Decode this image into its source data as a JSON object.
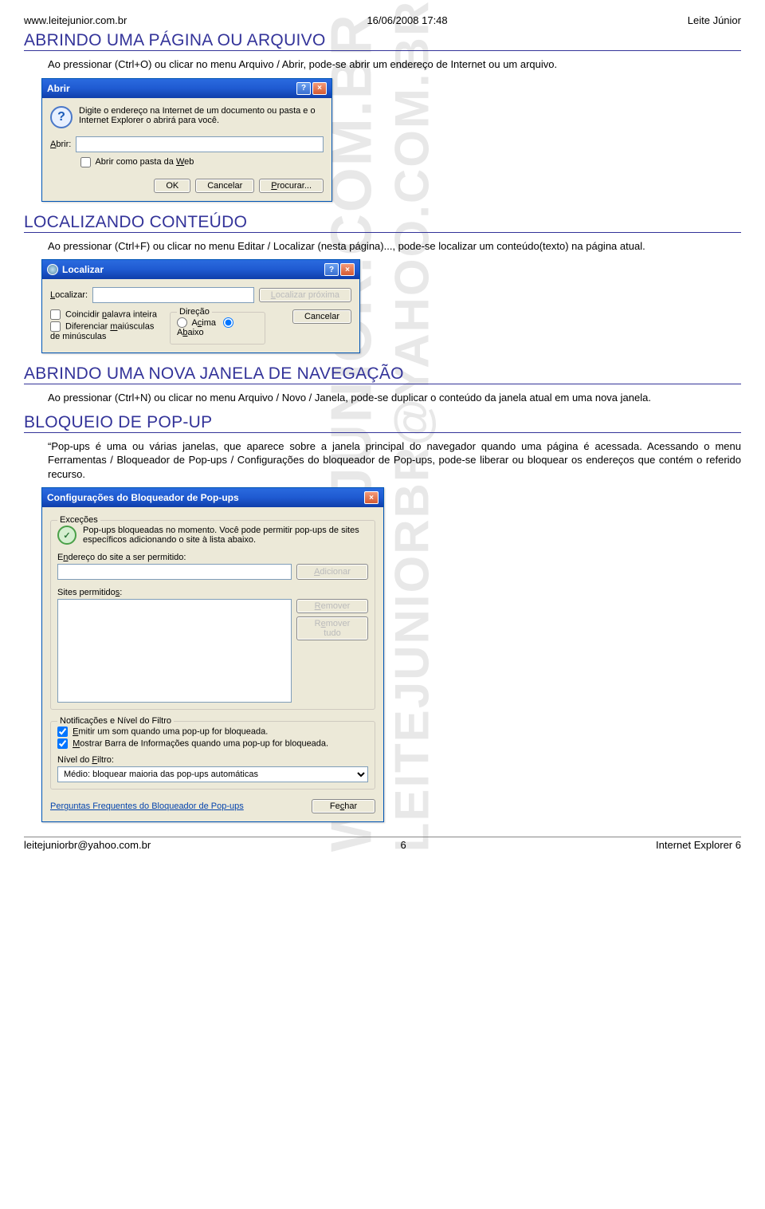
{
  "header": {
    "left": "www.leitejunior.com.br",
    "center": "16/06/2008 17:48",
    "right": "Leite Júnior"
  },
  "sections": {
    "s1": {
      "title": "ABRINDO UMA PÁGINA OU ARQUIVO",
      "para": "Ao pressionar (Ctrl+O) ou clicar no menu Arquivo / Abrir, pode-se abrir um endereço de Internet ou um arquivo."
    },
    "s2": {
      "title": "LOCALIZANDO CONTEÚDO",
      "para": "Ao pressionar (Ctrl+F) ou clicar no menu Editar / Localizar (nesta página)..., pode-se localizar um conteúdo(texto) na página atual."
    },
    "s3": {
      "title": "ABRINDO UMA NOVA JANELA DE NAVEGAÇÃO",
      "para": "Ao pressionar (Ctrl+N) ou clicar no menu Arquivo / Novo / Janela, pode-se duplicar o conteúdo da janela atual em uma nova janela."
    },
    "s4": {
      "title": "BLOQUEIO DE POP-UP",
      "para": "“Pop-ups é uma ou várias janelas, que aparece sobre a janela principal do navegador quando uma página é acessada. Acessando o menu Ferramentas / Bloqueador de Pop-ups / Configurações do bloqueador de Pop-ups, pode-se liberar ou bloquear os endereços que contém o referido recurso."
    }
  },
  "abrir_dialog": {
    "title": "Abrir",
    "prompt": "Digite o endereço na Internet de um documento ou pasta e o Internet Explorer o abrirá para você.",
    "label_abrir": "Abrir:",
    "check_web": "Abrir como pasta da Web",
    "btn_ok": "OK",
    "btn_cancel": "Cancelar",
    "btn_browse": "Procurar..."
  },
  "localizar_dialog": {
    "title": "Localizar",
    "label_localizar": "Localizar:",
    "btn_next": "Localizar próxima",
    "btn_cancel": "Cancelar",
    "check_word": "Coincidir palavra inteira",
    "check_case": "Diferenciar maiúsculas de minúsculas",
    "group_direcao": "Direção",
    "radio_up": "Acima",
    "radio_down": "Abaixo"
  },
  "popup_dialog": {
    "title": "Configurações do Bloqueador de Pop-ups",
    "group_ex": "Exceções",
    "ex_text": "Pop-ups bloqueadas no momento. Você pode permitir pop-ups de sites específicos adicionando o site à lista abaixo.",
    "label_addr": "Endereço do site a ser permitido:",
    "btn_add": "Adicionar",
    "label_allowed": "Sites permitidos:",
    "btn_remove": "Remover",
    "btn_remove_all": "Remover tudo",
    "group_notif": "Notificações e Nível do Filtro",
    "check_sound": "Emitir um som quando uma pop-up for bloqueada.",
    "check_bar": "Mostrar Barra de Informações quando uma pop-up for bloqueada.",
    "label_level": "Nível do Filtro:",
    "select_level": "Médio: bloquear maioria das pop-ups automáticas",
    "link_faq": "Perguntas Frequentes do Bloqueador de Pop-ups",
    "btn_close": "Fechar"
  },
  "footer": {
    "left": "leitejuniorbr@yahoo.com.br",
    "center": "6",
    "right": "Internet Explorer 6"
  },
  "watermark": {
    "line1": "WWW.LEITEJUNIOR.COM.BR",
    "line2": "LEITEJUNIORBR@YAHOO.COM.BR"
  }
}
